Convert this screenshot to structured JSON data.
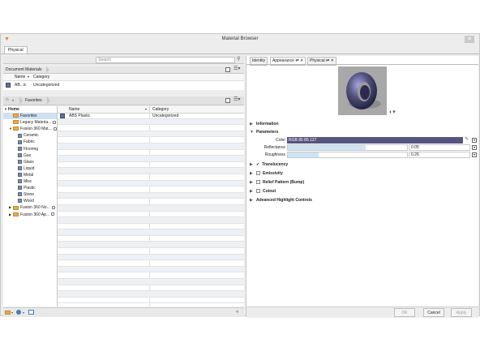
{
  "window": {
    "title": "Material Browser",
    "close_glyph": "✕",
    "app_icon": "fusion-icon"
  },
  "tabs": {
    "physical": "Physical"
  },
  "left": {
    "search_placeholder": "Search",
    "document_materials": {
      "title": "Document Materials",
      "col_name": "Name",
      "col_category": "Category",
      "row": {
        "name": "AB...ic",
        "category": "Uncategorized"
      }
    },
    "breadcrumb": {
      "home_glyph": "⌂",
      "item": "Favorites"
    },
    "tree": [
      {
        "label": "Home",
        "level": 0,
        "type": "section",
        "expanded": true
      },
      {
        "label": "Favorites",
        "level": 1,
        "type": "folder",
        "selected": true
      },
      {
        "label": "Legacy Materia...",
        "level": 1,
        "type": "folder",
        "locked": true
      },
      {
        "label": "Fusion 360 Mat...",
        "level": 1,
        "type": "folder",
        "locked": true,
        "expanded": true
      },
      {
        "label": "Ceramic",
        "level": 2,
        "type": "lib"
      },
      {
        "label": "Fabric",
        "level": 2,
        "type": "lib"
      },
      {
        "label": "Flooring",
        "level": 2,
        "type": "lib"
      },
      {
        "label": "Gas",
        "level": 2,
        "type": "lib"
      },
      {
        "label": "Glass",
        "level": 2,
        "type": "lib"
      },
      {
        "label": "Liquid",
        "level": 2,
        "type": "lib"
      },
      {
        "label": "Metal",
        "level": 2,
        "type": "lib"
      },
      {
        "label": "Misc",
        "level": 2,
        "type": "lib"
      },
      {
        "label": "Plastic",
        "level": 2,
        "type": "lib"
      },
      {
        "label": "Stone",
        "level": 2,
        "type": "lib"
      },
      {
        "label": "Wood",
        "level": 2,
        "type": "lib"
      },
      {
        "label": "Fusion 360 No...",
        "level": 1,
        "type": "folder",
        "locked": true,
        "collapsed": true
      },
      {
        "label": "Fusion 360 Ap...",
        "level": 1,
        "type": "folder",
        "locked": true,
        "collapsed": true
      }
    ],
    "list": {
      "col_name": "Name",
      "col_category": "Category",
      "rows": [
        {
          "name": "ABS Plastic",
          "category": "Uncategorized"
        }
      ]
    },
    "bottom": {
      "collapse_glyph": "«"
    }
  },
  "right": {
    "tabs": [
      {
        "label": "Identity",
        "active": false
      },
      {
        "label": "Appearance",
        "active": true
      },
      {
        "label": "Physical",
        "active": false
      }
    ],
    "sections": {
      "information": "Information",
      "parameters": "Parameters",
      "translucency": "Translucency",
      "emissivity": "Emissivity",
      "relief": "Relief Pattern (Bump)",
      "cutout": "Cutout",
      "advanced": "Advanced Highlight Controls"
    },
    "params": {
      "color_label": "Color",
      "color_value": "RGB 85 85 127",
      "color_hex": "#55557f",
      "reflectance_label": "Reflectance",
      "reflectance_value": "0.05",
      "roughness_label": "Roughness",
      "roughness_value": "0.26"
    },
    "buttons": {
      "ok": "OK",
      "cancel": "Cancel",
      "apply": "Apply"
    }
  }
}
